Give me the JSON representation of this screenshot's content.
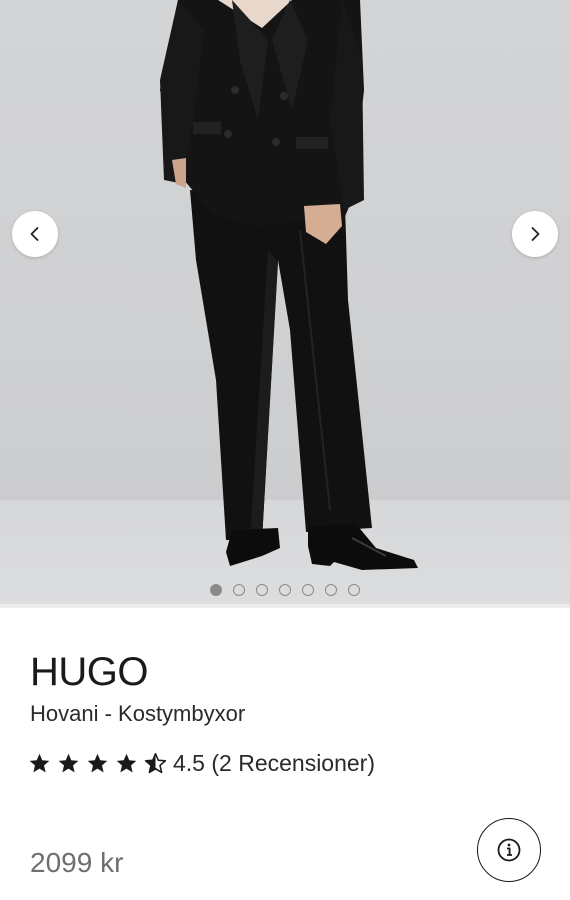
{
  "gallery": {
    "image_alt": "Model wearing black double-breasted blazer and black straight-leg suit trousers with black ankle boots",
    "slide_count": 7,
    "active_slide": 0,
    "prev_icon": "chevron-left-icon",
    "next_icon": "chevron-right-icon"
  },
  "product": {
    "brand": "HUGO",
    "name": "Hovani - Kostymbyxor",
    "rating_value": 4.5,
    "rating_text": "4.5 (2 Recensioner)",
    "price": "2099 kr"
  },
  "colors": {
    "text": "#1a1a1a",
    "price": "#6f6f6f",
    "dot": "#8a8a8a",
    "background": "#ffffff"
  }
}
